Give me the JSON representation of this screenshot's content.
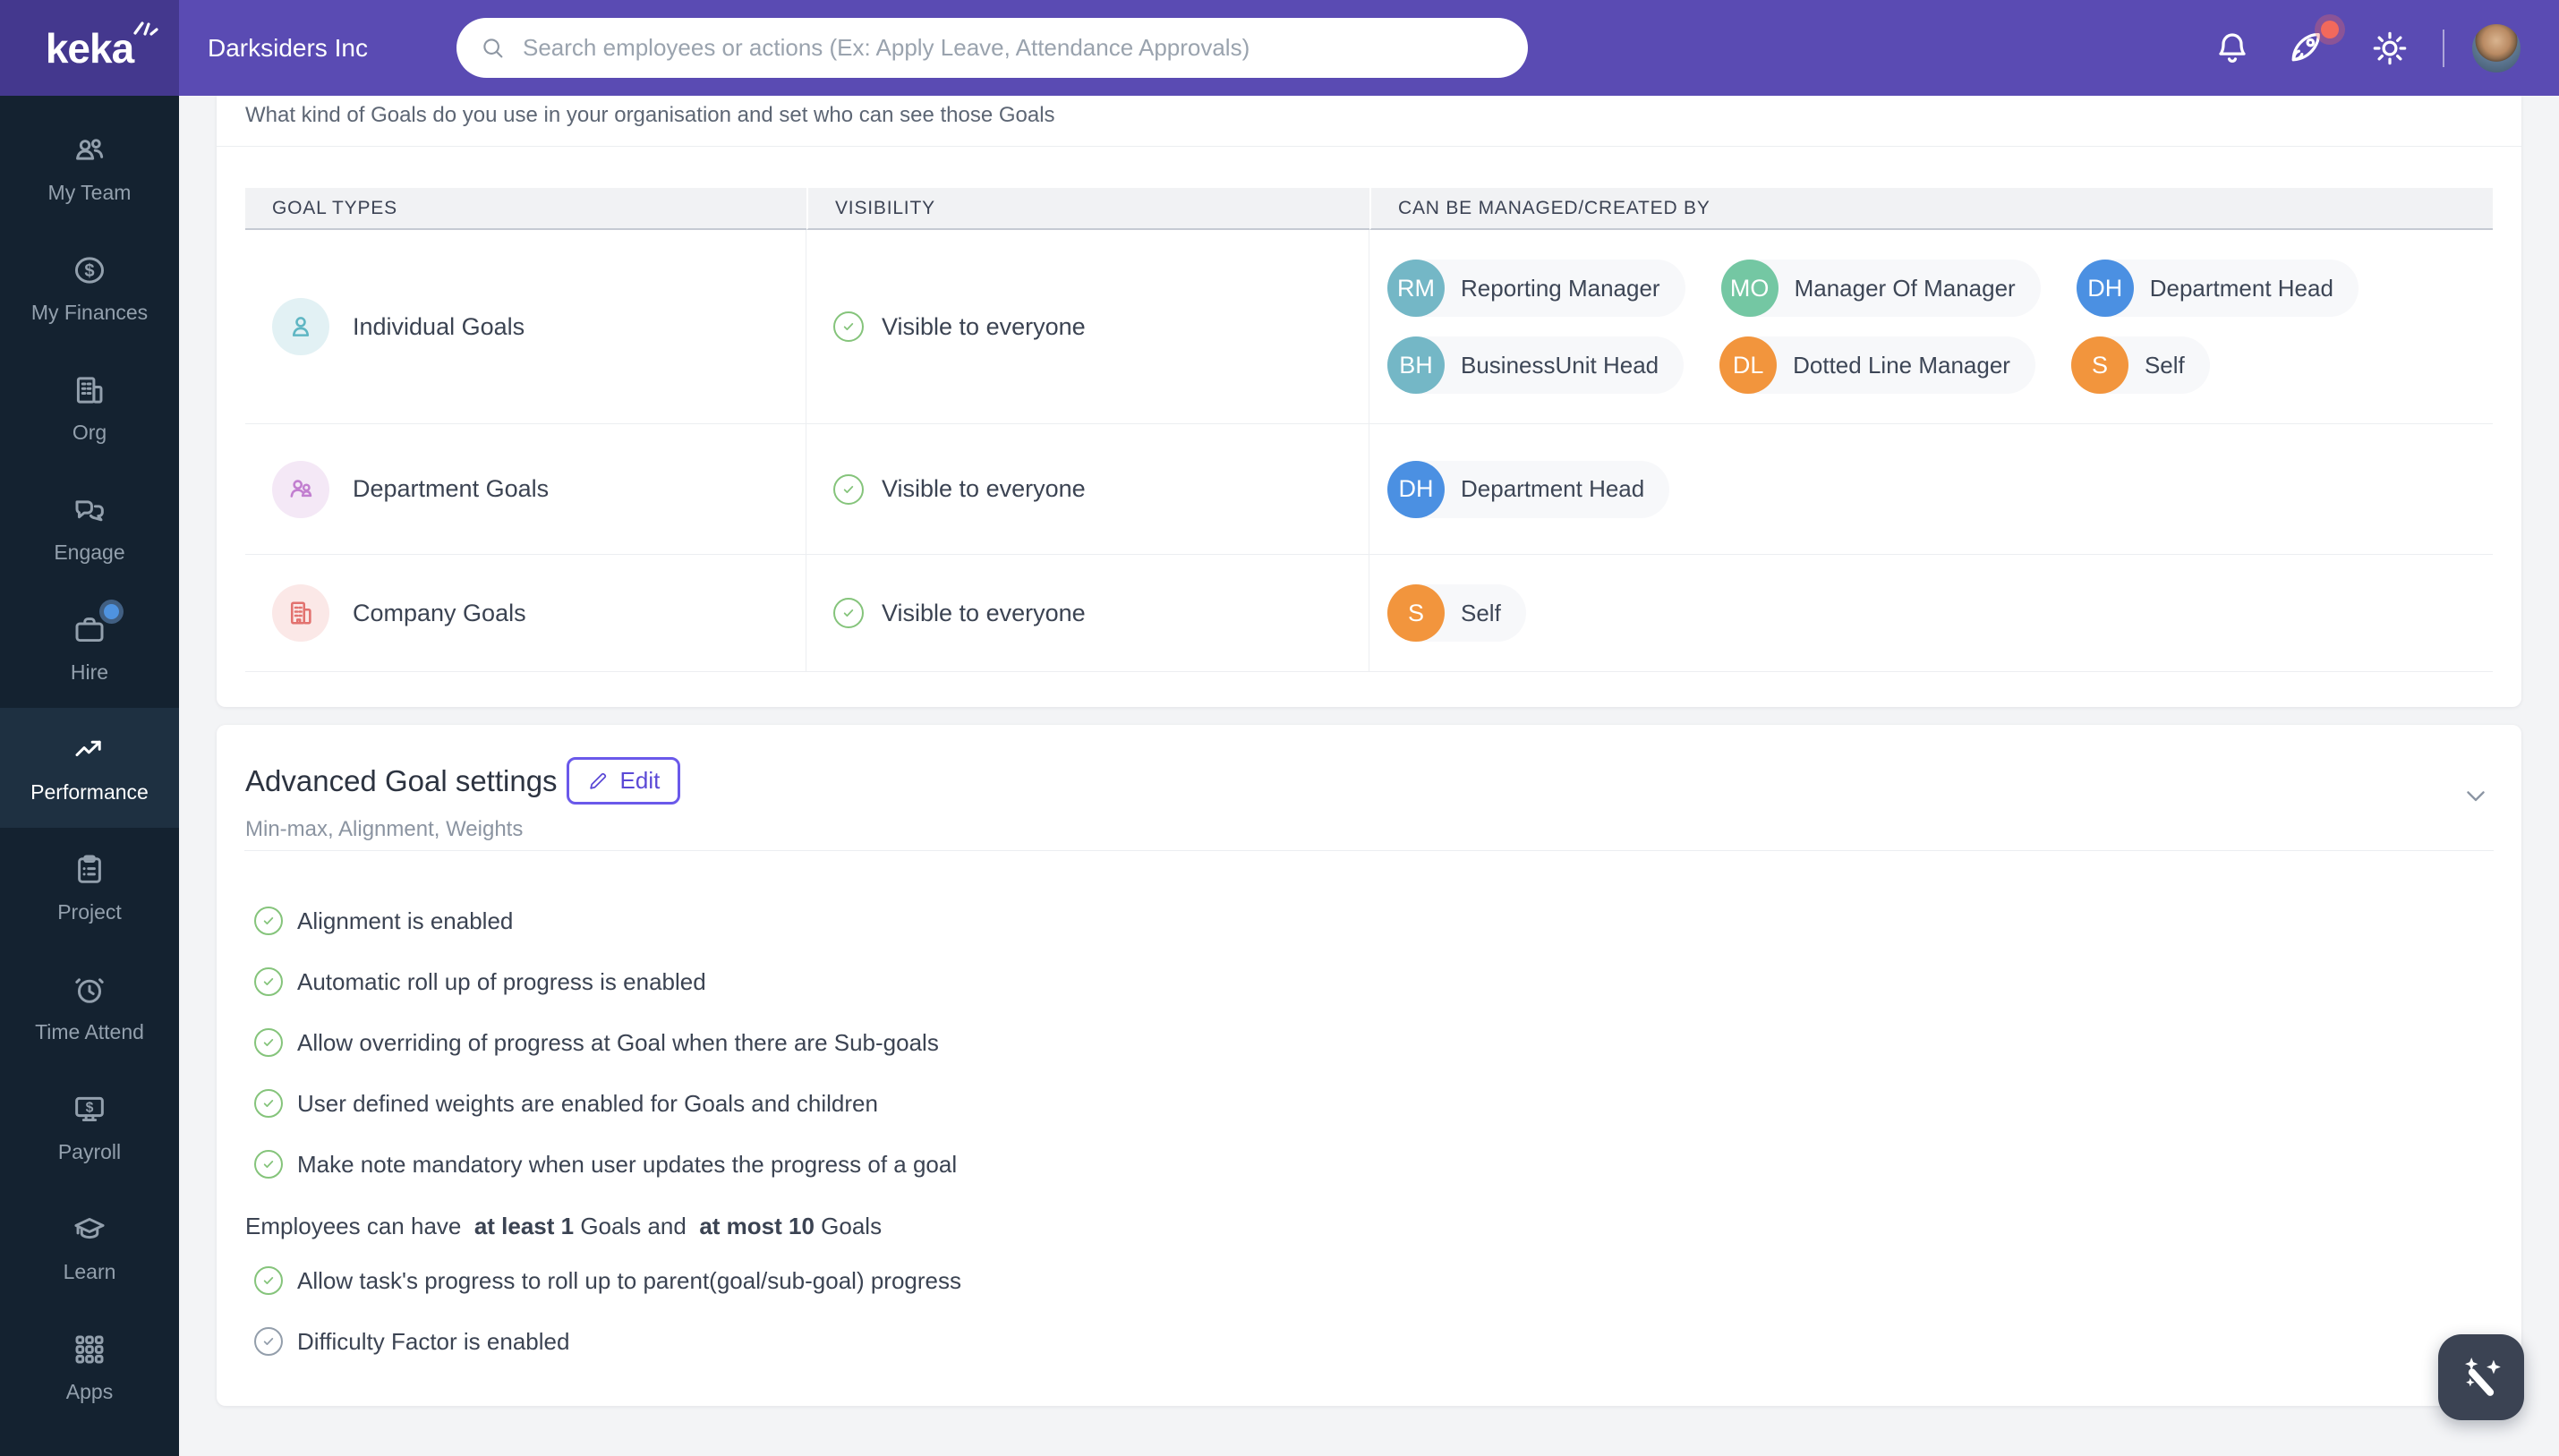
{
  "brand": {
    "logo": "keka"
  },
  "topbar": {
    "company": "Darksiders Inc",
    "search_placeholder": "Search employees or actions (Ex: Apply Leave, Attendance Approvals)"
  },
  "colors": {
    "topbar": "#5a4bb3",
    "logo_block": "#44388e",
    "sidebar": "#142230",
    "sidebar_active": "#1e3041",
    "accent_purple": "#5b49d6",
    "check_green": "#85c47b",
    "check_gray": "#939eab",
    "notification_red": "#f2695c",
    "fab": "#3b4353"
  },
  "sidebar": {
    "items": [
      {
        "label": "My Team",
        "icon": "people"
      },
      {
        "label": "My Finances",
        "icon": "dollar-circle"
      },
      {
        "label": "Org",
        "icon": "building"
      },
      {
        "label": "Engage",
        "icon": "chat"
      },
      {
        "label": "Hire",
        "icon": "briefcase",
        "dot": true
      },
      {
        "label": "Performance",
        "icon": "trend-up",
        "active": true
      },
      {
        "label": "Project",
        "icon": "clipboard"
      },
      {
        "label": "Time Attend",
        "icon": "alarm-clock"
      },
      {
        "label": "Payroll",
        "icon": "monitor-dollar"
      },
      {
        "label": "Learn",
        "icon": "graduation-cap"
      },
      {
        "label": "Apps",
        "icon": "grid"
      }
    ]
  },
  "page": {
    "intro": "What kind of Goals do you use in your organisation and set who can see those Goals",
    "table": {
      "headers": [
        "GOAL TYPES",
        "VISIBILITY",
        "CAN BE MANAGED/CREATED BY"
      ],
      "rows": [
        {
          "goal_type": "Individual Goals",
          "icon": "person",
          "icon_color": "#5fb6c3",
          "icon_bg": "#e2f1f4",
          "visibility": "Visible to everyone",
          "managed_by": [
            {
              "initials": "RM",
              "label": "Reporting Manager",
              "color": "#74b7c6"
            },
            {
              "initials": "MO",
              "label": "Manager Of Manager",
              "color": "#74c7a3"
            },
            {
              "initials": "DH",
              "label": "Department Head",
              "color": "#4b90e2"
            },
            {
              "initials": "BH",
              "label": "BusinessUnit Head",
              "color": "#74b7c6"
            },
            {
              "initials": "DL",
              "label": "Dotted Line Manager",
              "color": "#f2953d"
            },
            {
              "initials": "S",
              "label": "Self",
              "color": "#f2953d"
            }
          ]
        },
        {
          "goal_type": "Department Goals",
          "icon": "people-pair",
          "icon_color": "#c27fd0",
          "icon_bg": "#f4e8f6",
          "visibility": "Visible to everyone",
          "managed_by": [
            {
              "initials": "DH",
              "label": "Department Head",
              "color": "#4b90e2"
            }
          ]
        },
        {
          "goal_type": "Company Goals",
          "icon": "office",
          "icon_color": "#e2726f",
          "icon_bg": "#fbe8e7",
          "visibility": "Visible to everyone",
          "managed_by": [
            {
              "initials": "S",
              "label": "Self",
              "color": "#f2953d"
            }
          ]
        }
      ]
    },
    "advanced": {
      "title": "Advanced Goal settings",
      "edit_label": "Edit",
      "subtitle": "Min-max, Alignment, Weights",
      "rows": [
        {
          "kind": "check",
          "state": "on",
          "text": "Alignment is enabled"
        },
        {
          "kind": "check",
          "state": "on",
          "text": "Automatic roll up of progress is enabled"
        },
        {
          "kind": "check",
          "state": "on",
          "text": "Allow overriding of progress at Goal when there are Sub-goals"
        },
        {
          "kind": "check",
          "state": "on",
          "text": "User defined weights are enabled for Goals and children"
        },
        {
          "kind": "check",
          "state": "on",
          "text": "Make note mandatory when user updates the progress of a goal"
        },
        {
          "kind": "limits",
          "parts": [
            {
              "text": "Employees can have  ",
              "bold": false
            },
            {
              "text": "at least 1",
              "bold": true
            },
            {
              "text": " Goals and  ",
              "bold": false
            },
            {
              "text": "at most 10",
              "bold": true
            },
            {
              "text": " Goals",
              "bold": false
            }
          ]
        },
        {
          "kind": "check",
          "state": "on",
          "text": "Allow task's progress to roll up to parent(goal/sub-goal) progress"
        },
        {
          "kind": "check",
          "state": "off",
          "text": "Difficulty Factor is enabled"
        }
      ]
    }
  }
}
